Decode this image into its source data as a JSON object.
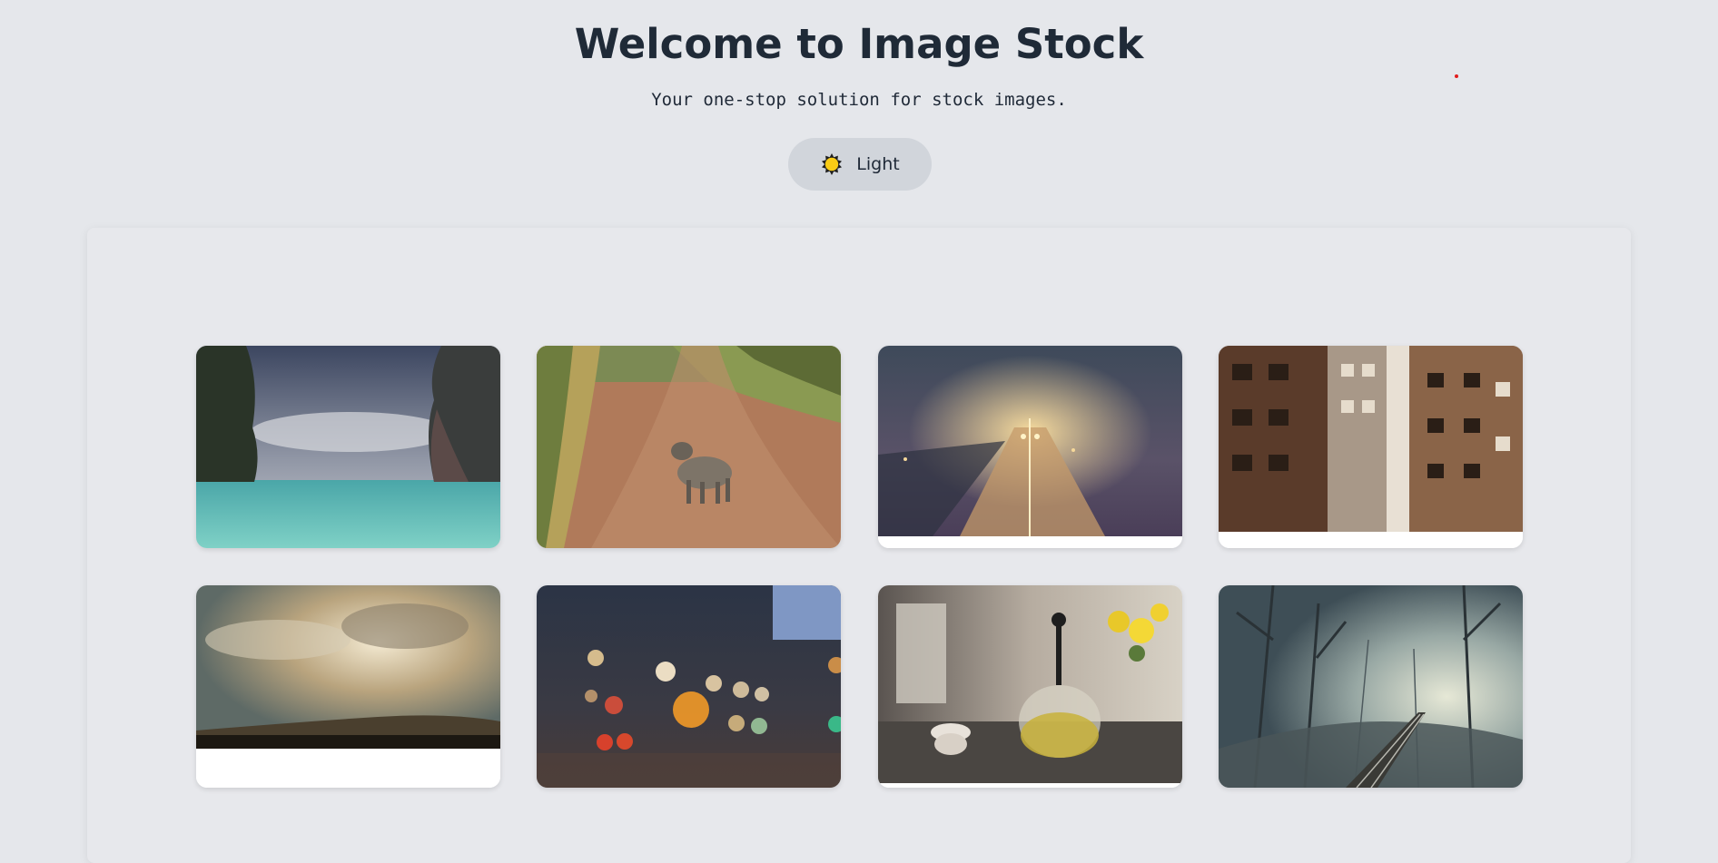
{
  "header": {
    "title": "Welcome to Image Stock",
    "subtitle": "Your one-stop solution for stock images."
  },
  "theme_toggle": {
    "icon": "sun-icon",
    "label": "Light"
  },
  "colors": {
    "background": "#e5e7eb",
    "panel": "#e7e8ec",
    "toggle_bg": "#d1d5db",
    "sun_fill": "#facc15",
    "indicator_dot": "#e11d1d"
  },
  "gallery": {
    "images": [
      {
        "subject": "tropical bay between limestone cliffs"
      },
      {
        "subject": "leopard on dirt road"
      },
      {
        "subject": "foggy train station at night"
      },
      {
        "subject": "city buildings with fire escapes"
      },
      {
        "subject": "sunbeams through clouds over hills"
      },
      {
        "subject": "city lights bokeh"
      },
      {
        "subject": "glass teapot with yellow roses"
      },
      {
        "subject": "railway through misty forest"
      }
    ]
  }
}
